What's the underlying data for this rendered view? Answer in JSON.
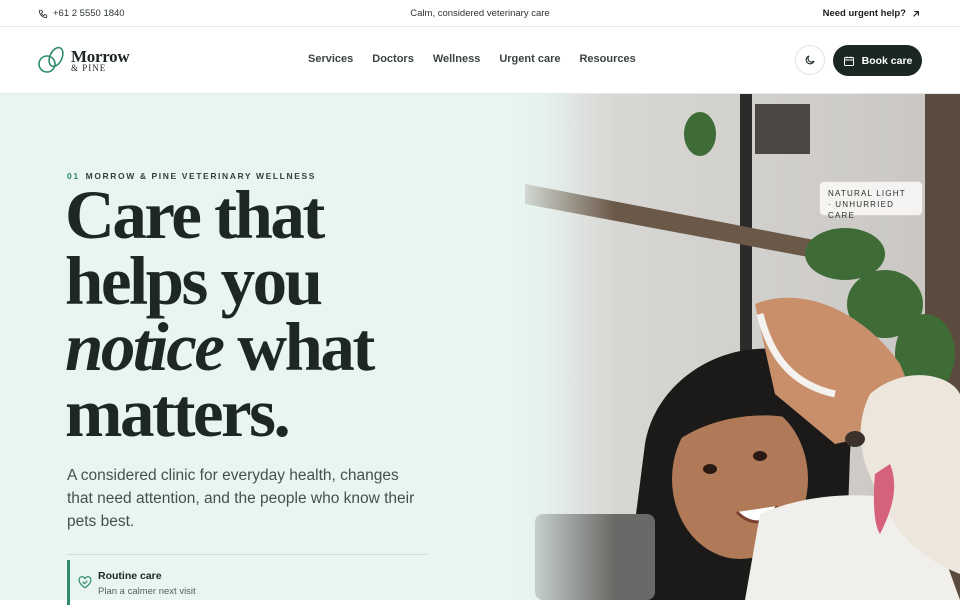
{
  "topbar": {
    "phone": "+61 2 5550 1840",
    "tagline": "Calm, considered veterinary care",
    "urgent": "Need urgent help?"
  },
  "brand": {
    "name_line1": "Morrow",
    "name_line2": "& PINE"
  },
  "nav": {
    "items": [
      "Services",
      "Doctors",
      "Wellness",
      "Urgent care",
      "Resources"
    ],
    "book_label": "Book care"
  },
  "hero": {
    "eyebrow_num": "01",
    "eyebrow_text": "MORROW & PINE VETERINARY WELLNESS",
    "headline_line1": "Care that",
    "headline_line2": "helps you",
    "headline_italic": "notice",
    "headline_line3_rest": " what",
    "headline_line4": "matters.",
    "lede": "A considered clinic for everyday health, changes that need attention, and the people who know their pets best.",
    "image_badge_line1": "NATURAL LIGHT",
    "image_badge_line2": "· UNHURRIED CARE"
  },
  "cards": [
    {
      "title": "Routine care",
      "subtitle": "Plan a calmer next visit",
      "icon": "heart-paw-icon"
    }
  ],
  "colors": {
    "accent": "#2f8a6e",
    "hero_bg": "#e8f5f1",
    "button_dark": "#1a2723"
  }
}
